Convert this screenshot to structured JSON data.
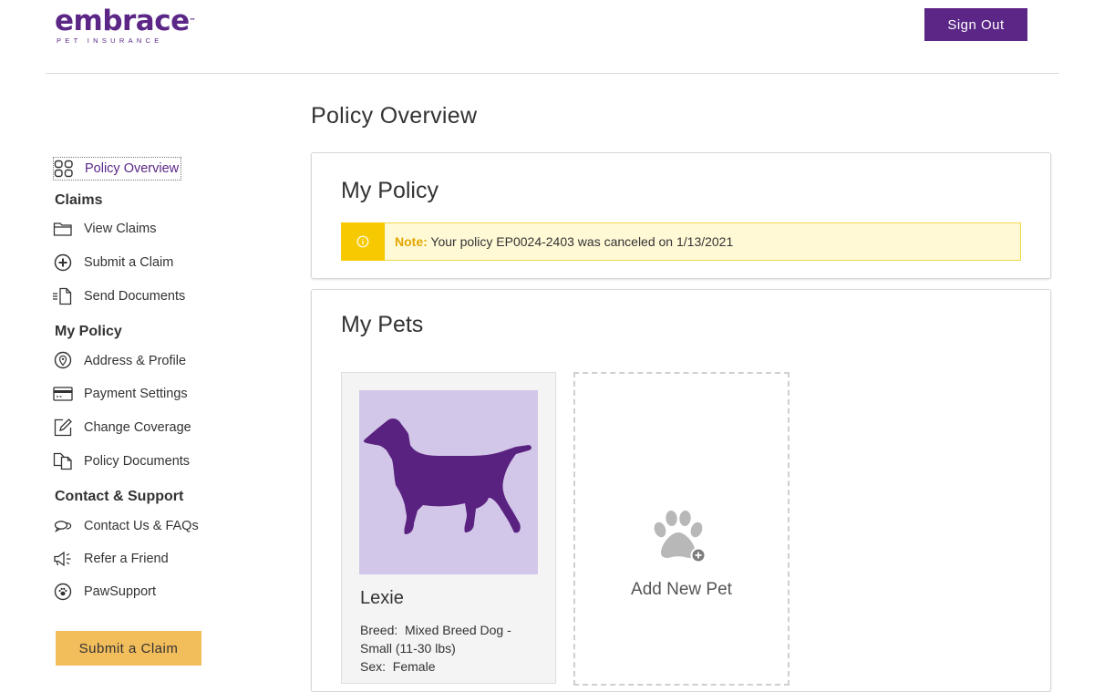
{
  "header": {
    "logo_text": "embrace",
    "logo_tm": "™",
    "logo_subtitle": "PET INSURANCE",
    "sign_out_label": "Sign Out"
  },
  "page_title": "Policy Overview",
  "sidebar": {
    "overview_label": "Policy Overview",
    "claims_heading": "Claims",
    "claims_items": [
      {
        "label": "View Claims",
        "icon": "folder-icon"
      },
      {
        "label": "Submit a Claim",
        "icon": "plus-circle-icon"
      },
      {
        "label": "Send Documents",
        "icon": "send-document-icon"
      }
    ],
    "policy_heading": "My Policy",
    "policy_items": [
      {
        "label": "Address & Profile",
        "icon": "location-pin-icon"
      },
      {
        "label": "Payment Settings",
        "icon": "credit-card-icon"
      },
      {
        "label": "Change Coverage",
        "icon": "edit-icon"
      },
      {
        "label": "Policy Documents",
        "icon": "documents-icon"
      }
    ],
    "support_heading": "Contact & Support",
    "support_items": [
      {
        "label": "Contact Us & FAQs",
        "icon": "chat-bubbles-icon"
      },
      {
        "label": "Refer a Friend",
        "icon": "megaphone-icon"
      },
      {
        "label": "PawSupport",
        "icon": "paw-circle-icon"
      }
    ],
    "submit_claim_button": "Submit a Claim"
  },
  "my_policy": {
    "title": "My Policy",
    "note_label": "Note:",
    "note_text": "Your policy EP0024-2403 was canceled on 1/13/2021"
  },
  "my_pets": {
    "title": "My Pets",
    "pets": [
      {
        "name": "Lexie",
        "breed_label": "Breed:",
        "breed": "Mixed Breed Dog - Small (11-30 lbs)",
        "sex_label": "Sex:",
        "sex": "Female"
      }
    ],
    "add_new_pet_label": "Add New Pet"
  },
  "colors": {
    "brand_purple": "#5b2686",
    "accent_yellow": "#f2bd5b",
    "note_yellow": "#f6c900",
    "pet_image_bg": "#d3c7e9"
  }
}
